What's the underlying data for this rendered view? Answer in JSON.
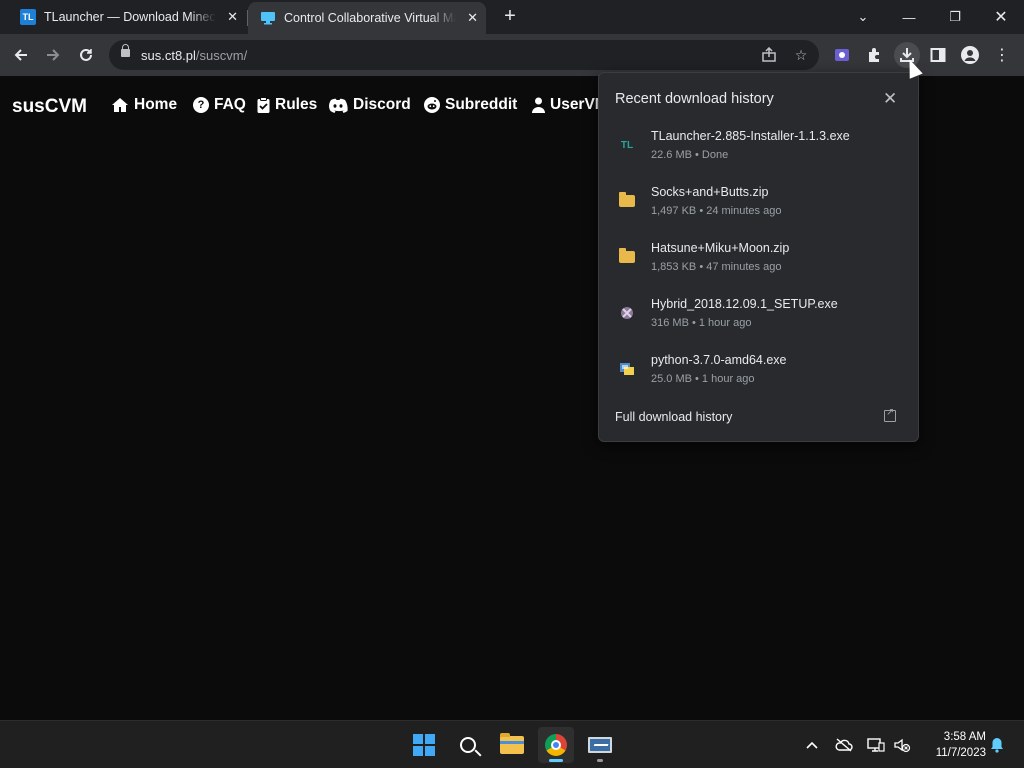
{
  "tabs": [
    {
      "favicon_text": "TL",
      "title": "TLauncher — Download Minecraft",
      "close": "✕"
    },
    {
      "favicon_icon": "monitor-icon",
      "title": "Control Collaborative Virtual Machines",
      "close": "✕"
    }
  ],
  "new_tab": "+",
  "window_controls": {
    "dropdown": "⌄",
    "minimize": "—",
    "restore": "❐",
    "close": "✕"
  },
  "address_bar": {
    "host": "sus.ct8.pl",
    "path": "/suscvm/"
  },
  "site": {
    "brand": "susCVM",
    "nav": [
      {
        "label": "Home",
        "icon": "home-icon"
      },
      {
        "label": "FAQ",
        "icon": "question-icon",
        "icon_glyph": "?"
      },
      {
        "label": "Rules",
        "icon": "clipboard-icon"
      },
      {
        "label": "Discord",
        "icon": "discord-icon"
      },
      {
        "label": "Subreddit",
        "icon": "reddit-icon"
      },
      {
        "label": "UserVM",
        "icon": "user-icon"
      }
    ]
  },
  "downloads": {
    "heading": "Recent download history",
    "close": "✕",
    "items": [
      {
        "name": "TLauncher-2.885-Installer-1.1.3.exe",
        "meta": "22.6 MB • Done",
        "icon": "tlauncher-icon",
        "icon_text": "TL"
      },
      {
        "name": "Socks+and+Butts.zip",
        "meta": "1,497 KB • 24 minutes ago",
        "icon": "zip-folder-icon"
      },
      {
        "name": "Hatsune+Miku+Moon.zip",
        "meta": "1,853 KB • 47 minutes ago",
        "icon": "zip-folder-icon"
      },
      {
        "name": "Hybrid_2018.12.09.1_SETUP.exe",
        "meta": "316 MB • 1 hour ago",
        "icon": "installer-icon"
      },
      {
        "name": "python-3.7.0-amd64.exe",
        "meta": "25.0 MB • 1 hour ago",
        "icon": "python-installer-icon"
      }
    ],
    "full_history": "Full download history"
  },
  "taskbar": {
    "clock_time": "3:58 AM",
    "clock_date": "11/7/2023"
  },
  "colors": {
    "accent": "#60cdff",
    "page_bg": "#0b0b0b",
    "panel_bg": "#292a2d",
    "toolbar_bg": "#35363a"
  }
}
